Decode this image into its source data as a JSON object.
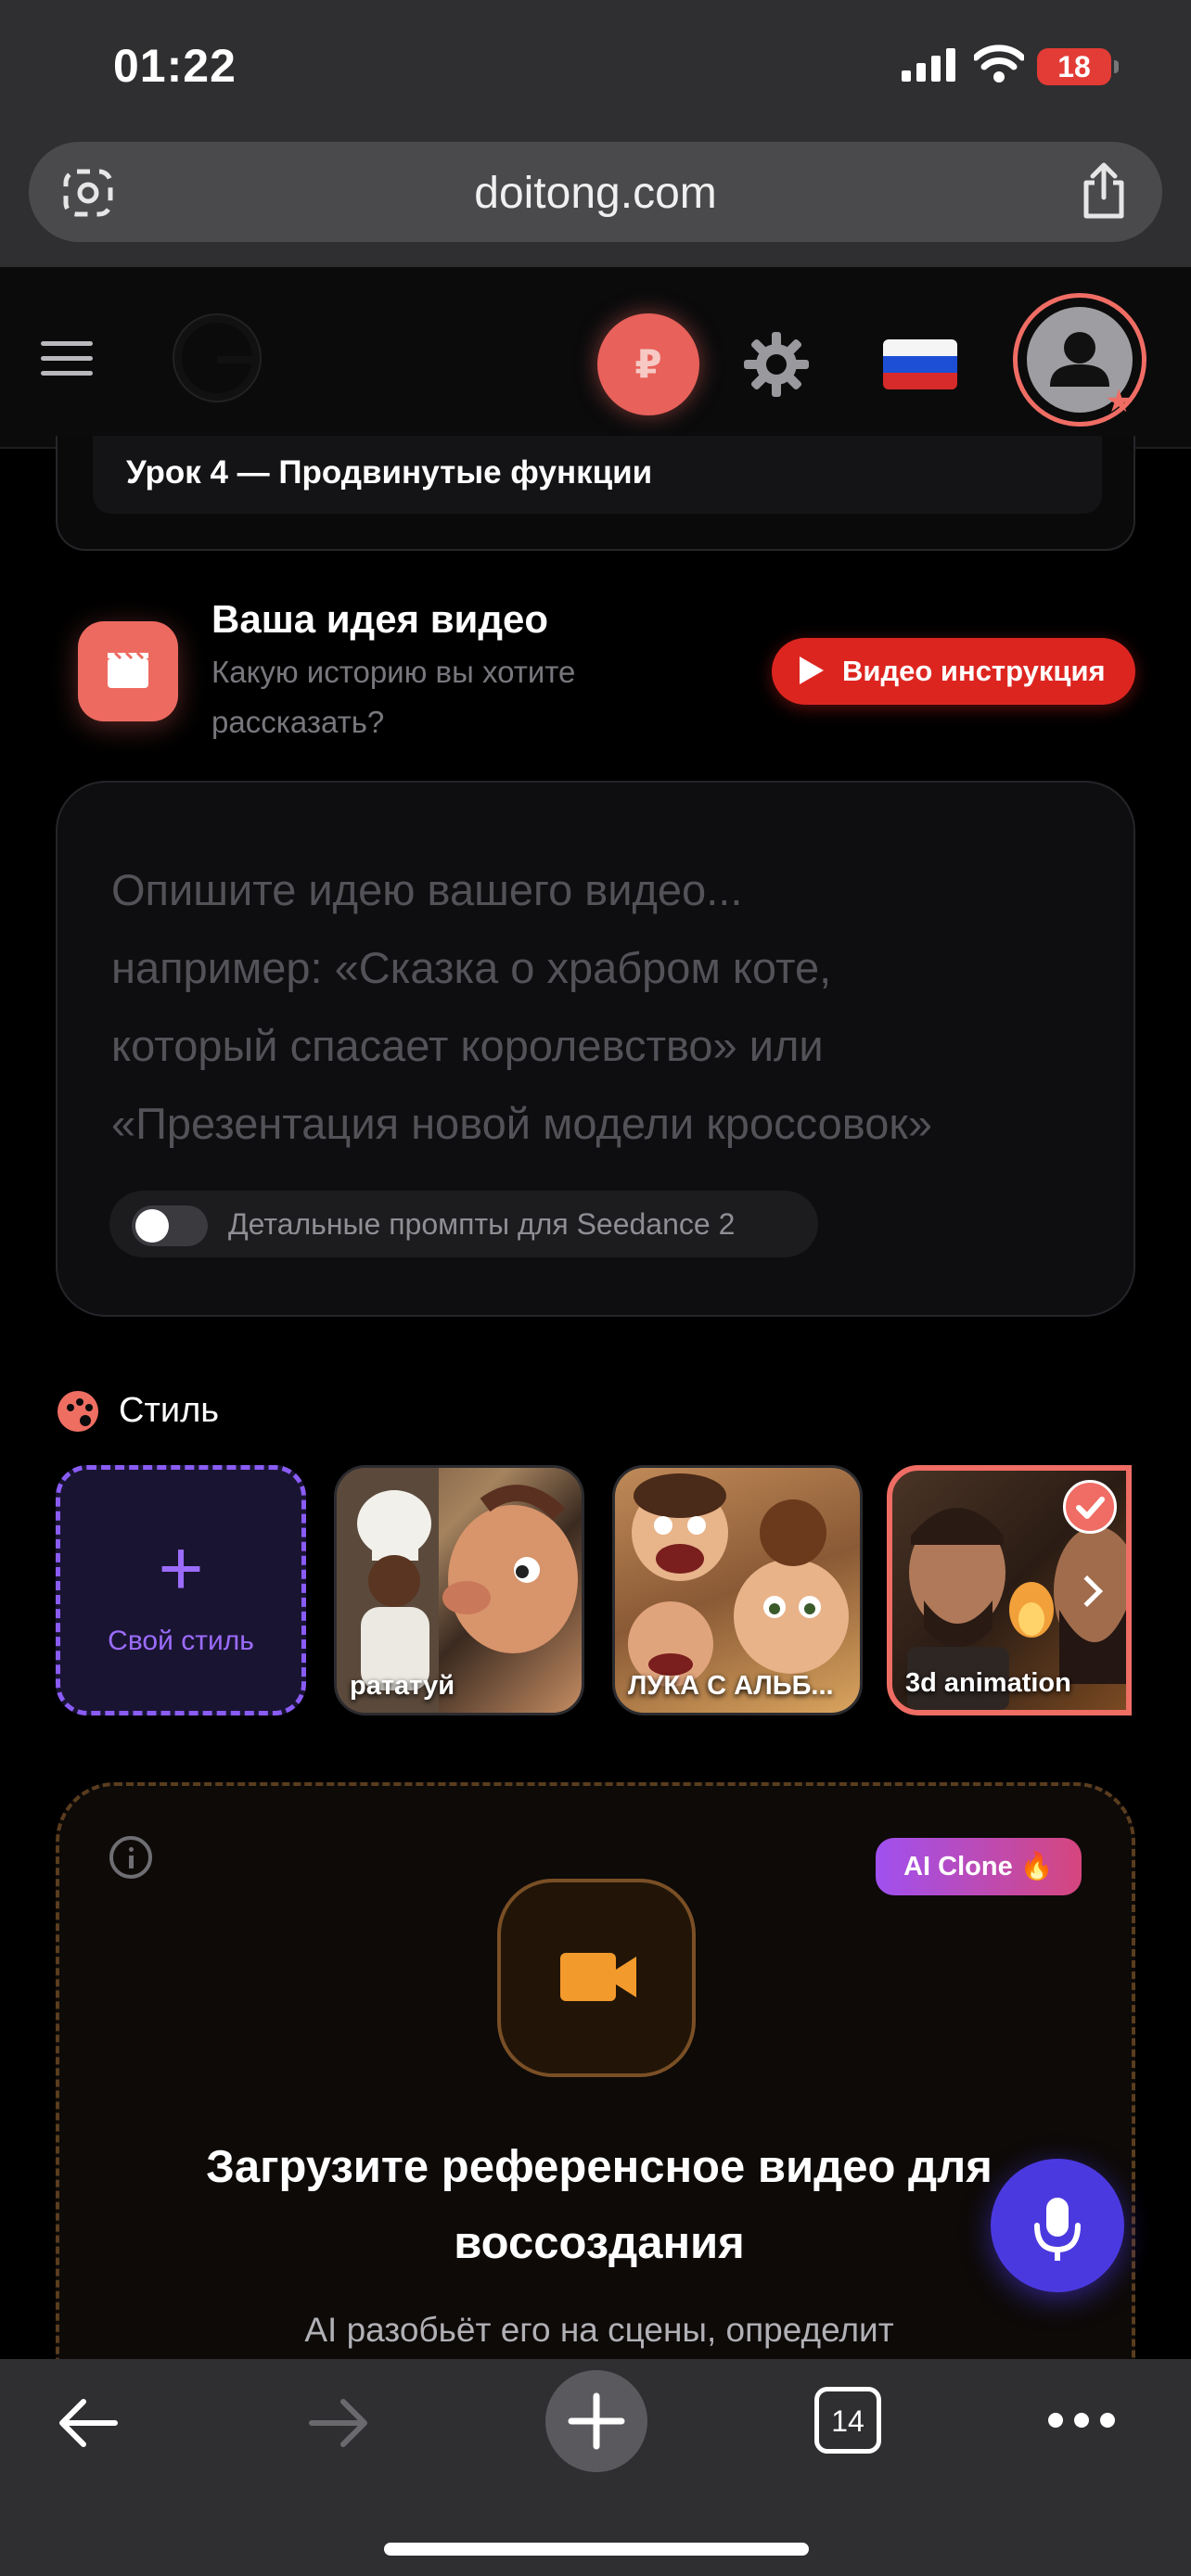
{
  "status_bar": {
    "time": "01:22",
    "battery_level": "18"
  },
  "browser": {
    "url": "doitong.com",
    "tabs_count": "14"
  },
  "header": {
    "currency_symbol": "₽",
    "language_flag": "russian-flag"
  },
  "lesson": {
    "title": "Урок 4 — Продвинутые функции"
  },
  "idea": {
    "title": "Ваша идея видео",
    "subtitle": "Какую историю вы хотите рассказать?",
    "video_guide_label": "Видео инструкция"
  },
  "prompt": {
    "placeholder": "Опишите идею вашего видео...\nнапример: «Сказка о храбром коте,\nкоторый спасает королевство» или\n«Презентация новой модели кроссовок»",
    "toggle_label": "Детальные промпты для Seedance 2",
    "toggle_on": false
  },
  "style": {
    "title": "Стиль",
    "custom_label": "Свой стиль",
    "items": [
      {
        "label": "рататуй",
        "selected": false
      },
      {
        "label": "ЛУКА С АЛЬБ...",
        "selected": false
      },
      {
        "label": "3d animation",
        "selected": true
      }
    ]
  },
  "upload": {
    "badge": "AI Clone 🔥",
    "title": "Загрузите референсное видео для воссоздания",
    "subtitle": "AI разобьёт его на сцены, определит"
  },
  "colors": {
    "accent": "#ef6d64",
    "violet": "#8a5cf6",
    "youtube_red": "#dd2520",
    "mic_blue": "#4b39e0"
  }
}
